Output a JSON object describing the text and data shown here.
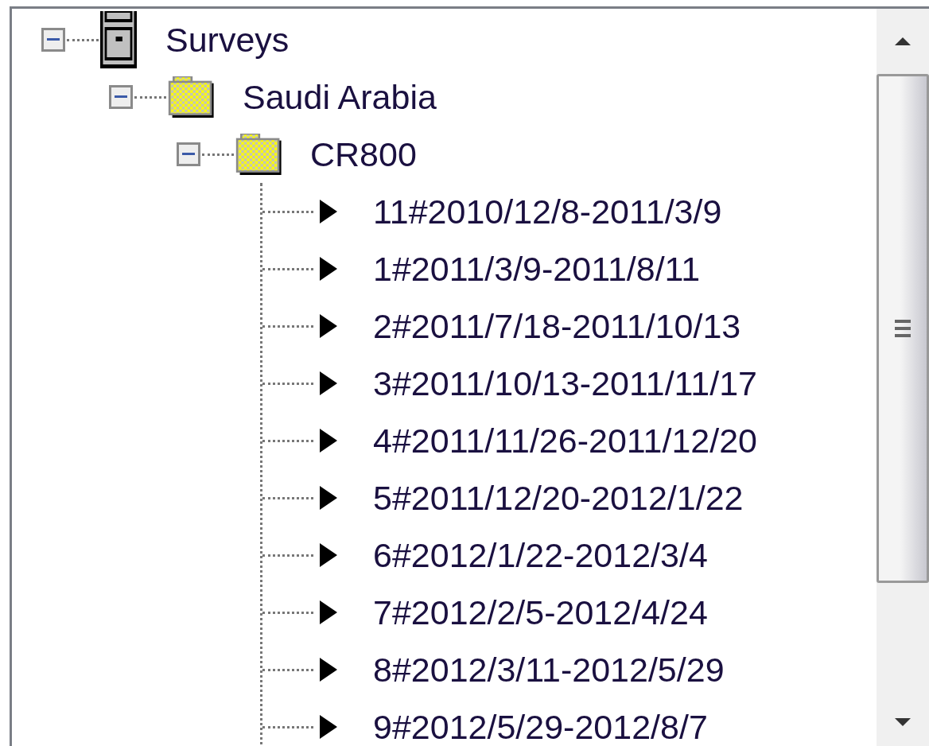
{
  "tree": [
    {
      "label": "Surveys",
      "kind": "cabinet",
      "expanded": true,
      "children": [
        {
          "label": "Saudi Arabia",
          "kind": "folder",
          "expanded": true,
          "children": [
            {
              "label": "CR800",
              "kind": "folder",
              "expanded": true,
              "children": [
                {
                  "label": "11#2010/12/8-2011/3/9",
                  "kind": "record"
                },
                {
                  "label": "1#2011/3/9-2011/8/11",
                  "kind": "record"
                },
                {
                  "label": "2#2011/7/18-2011/10/13",
                  "kind": "record"
                },
                {
                  "label": "3#2011/10/13-2011/11/17",
                  "kind": "record"
                },
                {
                  "label": "4#2011/11/26-2011/12/20",
                  "kind": "record"
                },
                {
                  "label": "5#2011/12/20-2012/1/22",
                  "kind": "record"
                },
                {
                  "label": "6#2012/1/22-2012/3/4",
                  "kind": "record"
                },
                {
                  "label": "7#2012/2/5-2012/4/24",
                  "kind": "record"
                },
                {
                  "label": "8#2012/3/11-2012/5/29",
                  "kind": "record"
                },
                {
                  "label": "9#2012/5/29-2012/8/7",
                  "kind": "record"
                }
              ]
            }
          ]
        }
      ]
    }
  ]
}
